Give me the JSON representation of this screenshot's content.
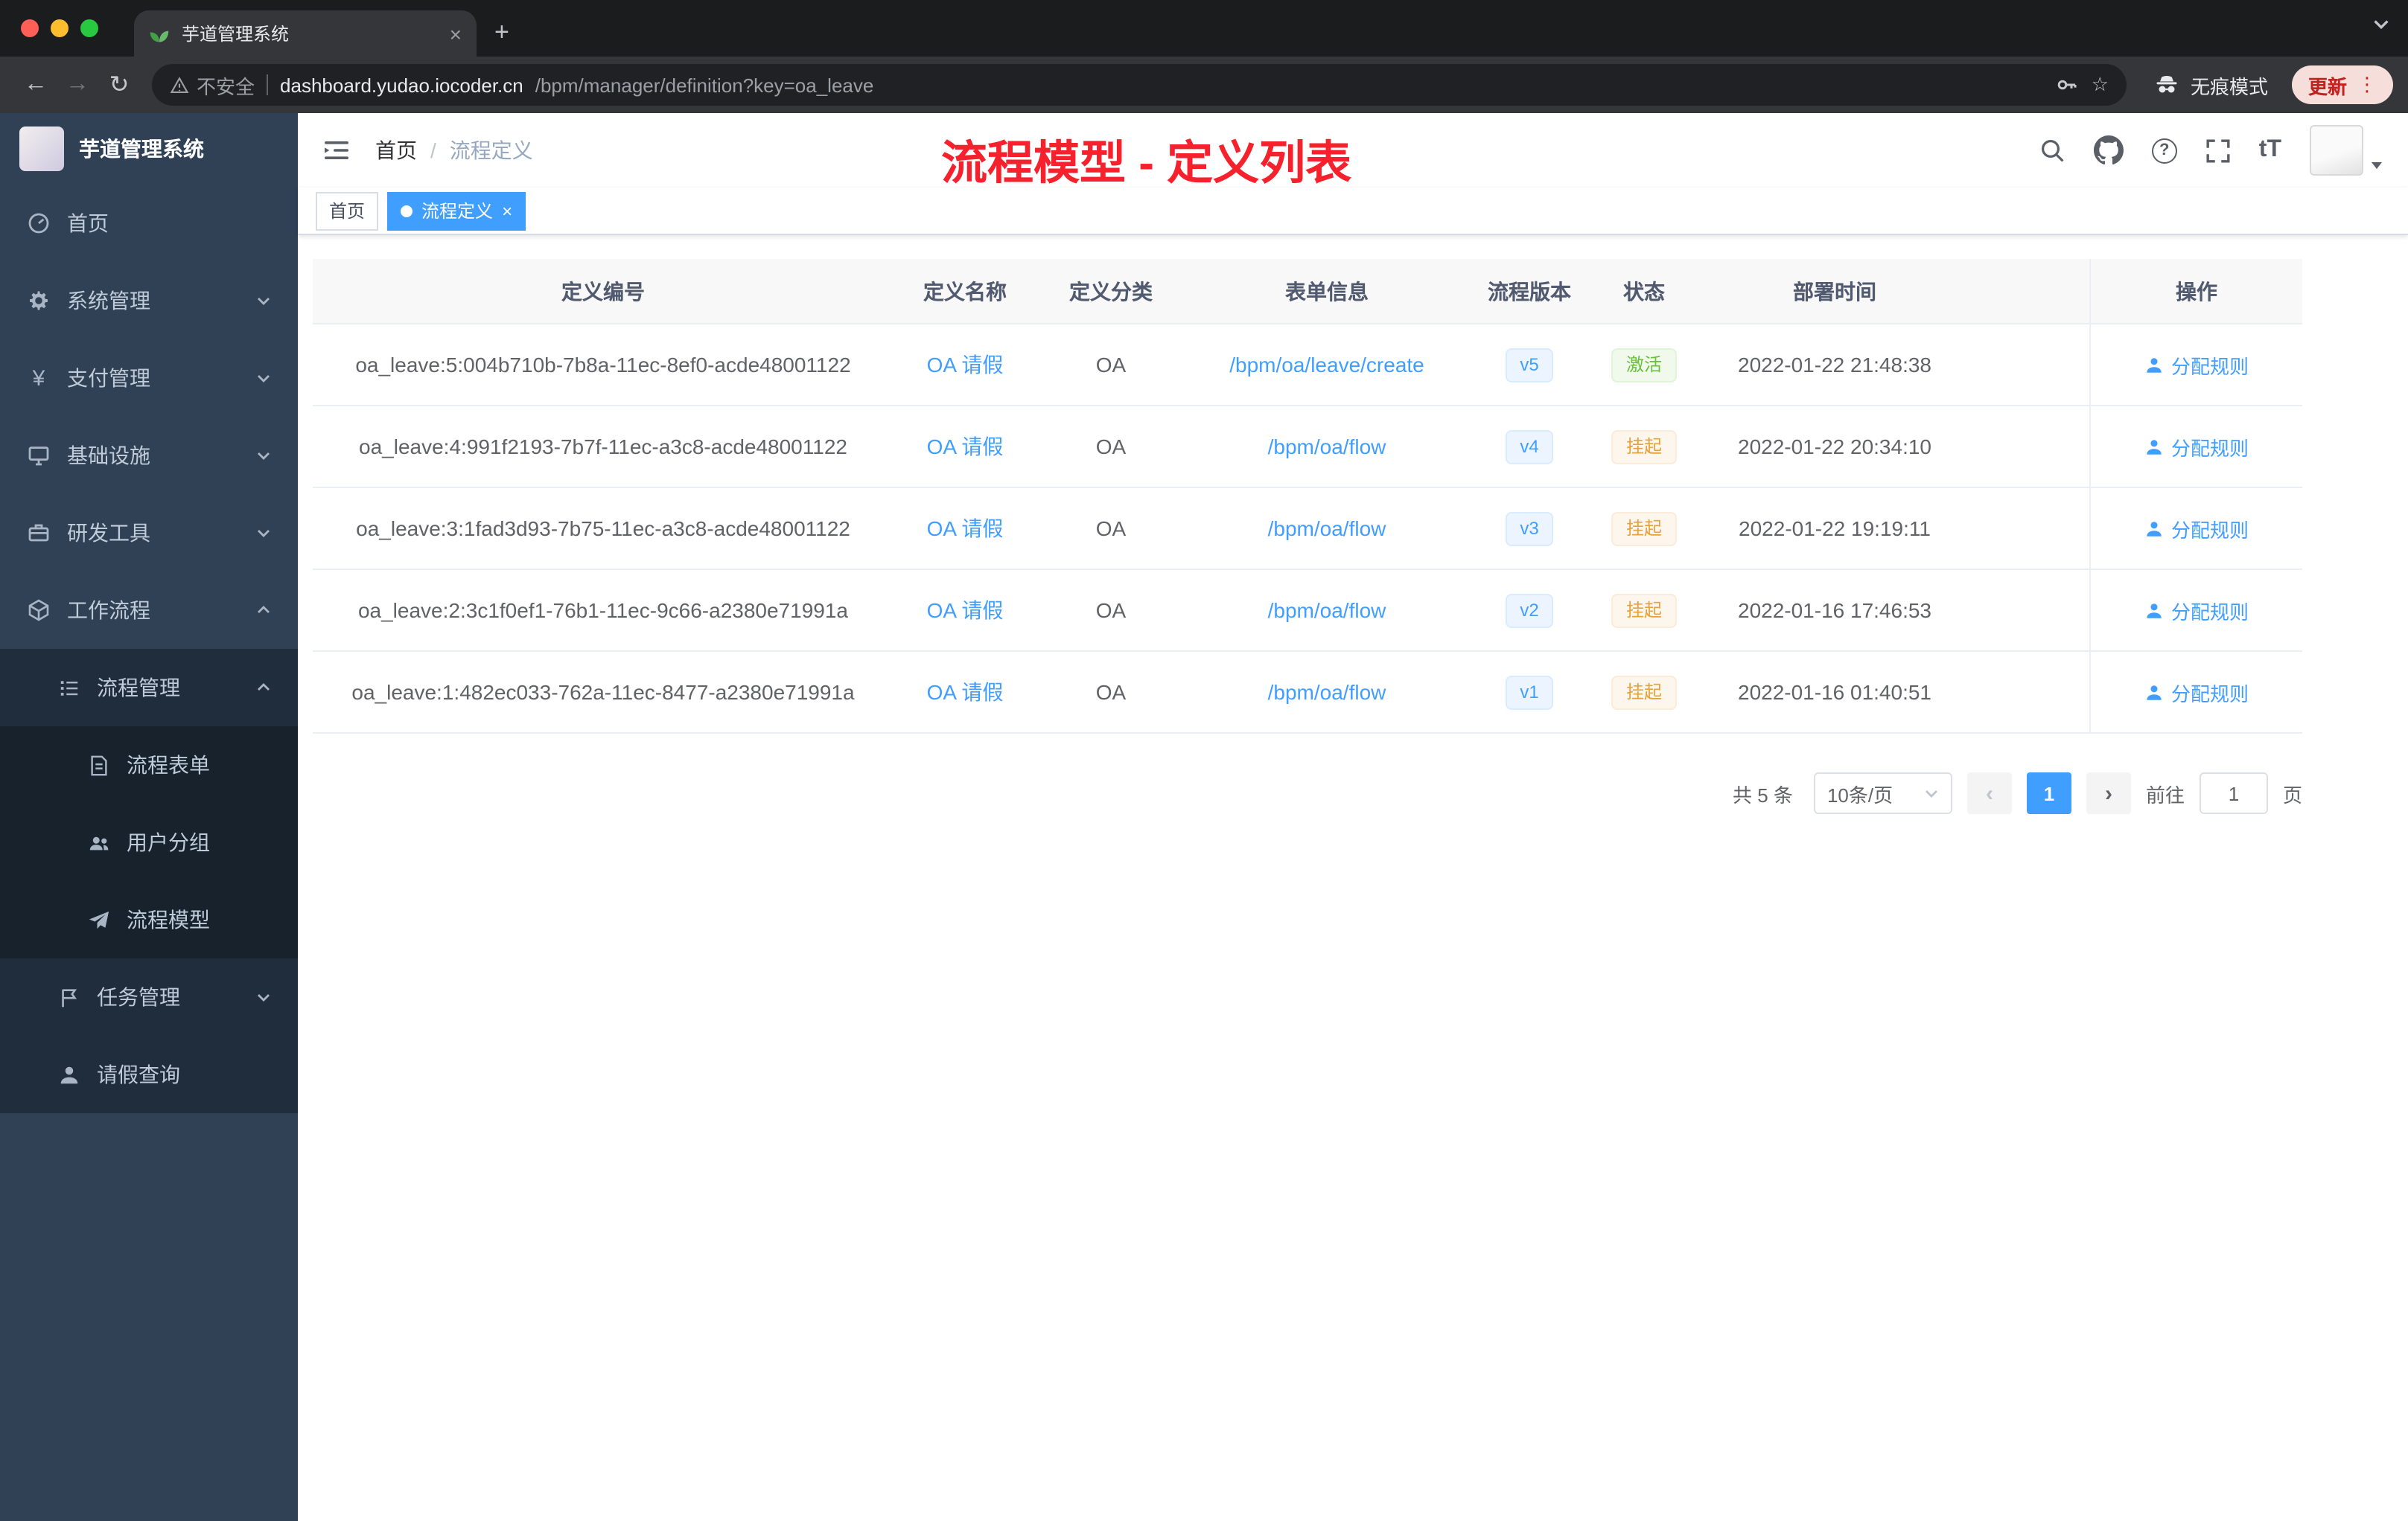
{
  "browser": {
    "tab_title": "芋道管理系统",
    "security_label": "不安全",
    "url_host": "dashboard.yudao.iocoder.cn",
    "url_path": "/bpm/manager/definition?key=oa_leave",
    "incognito_label": "无痕模式",
    "update_label": "更新"
  },
  "sidebar": {
    "logo_title": "芋道管理系统",
    "items": [
      {
        "label": "首页"
      },
      {
        "label": "系统管理"
      },
      {
        "label": "支付管理"
      },
      {
        "label": "基础设施"
      },
      {
        "label": "研发工具"
      },
      {
        "label": "工作流程"
      },
      {
        "label": "流程管理"
      },
      {
        "label": "流程表单"
      },
      {
        "label": "用户分组"
      },
      {
        "label": "流程模型"
      },
      {
        "label": "任务管理"
      },
      {
        "label": "请假查询"
      }
    ]
  },
  "header": {
    "breadcrumb_home": "首页",
    "breadcrumb_current": "流程定义",
    "annotation": "流程模型 - 定义列表"
  },
  "tags": {
    "home": "首页",
    "active": "流程定义"
  },
  "table": {
    "columns": [
      "定义编号",
      "定义名称",
      "定义分类",
      "表单信息",
      "流程版本",
      "状态",
      "部署时间",
      "操作"
    ],
    "action_label": "分配规则",
    "rows": [
      {
        "id": "oa_leave:5:004b710b-7b8a-11ec-8ef0-acde48001122",
        "name": "OA 请假",
        "category": "OA",
        "form": "/bpm/oa/leave/create",
        "version": "v5",
        "status": "激活",
        "time": "2022-01-22 21:48:38"
      },
      {
        "id": "oa_leave:4:991f2193-7b7f-11ec-a3c8-acde48001122",
        "name": "OA 请假",
        "category": "OA",
        "form": "/bpm/oa/flow",
        "version": "v4",
        "status": "挂起",
        "time": "2022-01-22 20:34:10"
      },
      {
        "id": "oa_leave:3:1fad3d93-7b75-11ec-a3c8-acde48001122",
        "name": "OA 请假",
        "category": "OA",
        "form": "/bpm/oa/flow",
        "version": "v3",
        "status": "挂起",
        "time": "2022-01-22 19:19:11"
      },
      {
        "id": "oa_leave:2:3c1f0ef1-76b1-11ec-9c66-a2380e71991a",
        "name": "OA 请假",
        "category": "OA",
        "form": "/bpm/oa/flow",
        "version": "v2",
        "status": "挂起",
        "time": "2022-01-16 17:46:53"
      },
      {
        "id": "oa_leave:1:482ec033-762a-11ec-8477-a2380e71991a",
        "name": "OA 请假",
        "category": "OA",
        "form": "/bpm/oa/flow",
        "version": "v1",
        "status": "挂起",
        "time": "2022-01-16 01:40:51"
      }
    ]
  },
  "pagination": {
    "total": "共 5 条",
    "page_size": "10条/页",
    "current_page": "1",
    "goto_label": "前往",
    "goto_value": "1",
    "page_unit": "页"
  },
  "colors": {
    "accent": "#409eff",
    "success": "#67c23a",
    "warning": "#e6a23c",
    "annotation": "#f5222d"
  }
}
